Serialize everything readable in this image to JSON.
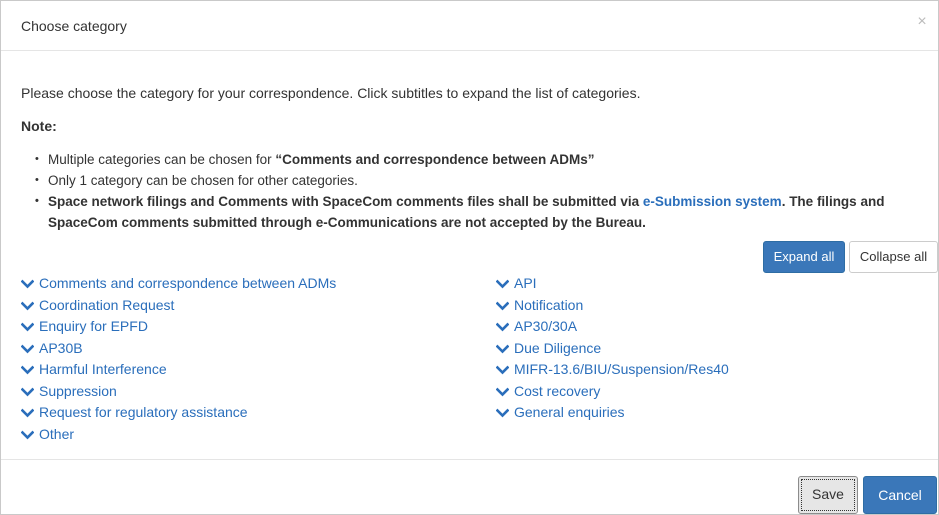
{
  "dialog": {
    "title": "Choose category",
    "close_symbol": "×"
  },
  "body": {
    "intro": "Please choose the category for your correspondence. Click subtitles to expand the list of categories.",
    "note_label": "Note:",
    "notes": {
      "item1_prefix": "Multiple categories can be chosen for ",
      "item1_bold": "“Comments and correspondence between ADMs”",
      "item2": "Only 1 category can be chosen for other categories.",
      "item3_prefix": "Space network filings and Comments with SpaceCom comments files shall be submitted via ",
      "item3_link": "e-Submission system",
      "item3_suffix": ". The filings and SpaceCom comments submitted through e-Communications are not accepted by the Bureau."
    }
  },
  "buttons": {
    "expand_all": "Expand all",
    "collapse_all": "Collapse all",
    "save": "Save",
    "cancel": "Cancel"
  },
  "categories": {
    "left": [
      "Comments and correspondence between ADMs",
      "Coordination Request",
      "Enquiry for EPFD",
      "AP30B",
      "Harmful Interference",
      "Suppression",
      "Request for regulatory assistance",
      "Other"
    ],
    "right": [
      "API",
      "Notification",
      "AP30/30A",
      "Due Diligence",
      "MIFR-13.6/BIU/Suspension/Res40",
      "Cost recovery",
      "General enquiries"
    ],
    "icon": "chevron-down-icon",
    "link_color": "#2a6ebb"
  },
  "colors": {
    "primary": "#3a77b9"
  }
}
